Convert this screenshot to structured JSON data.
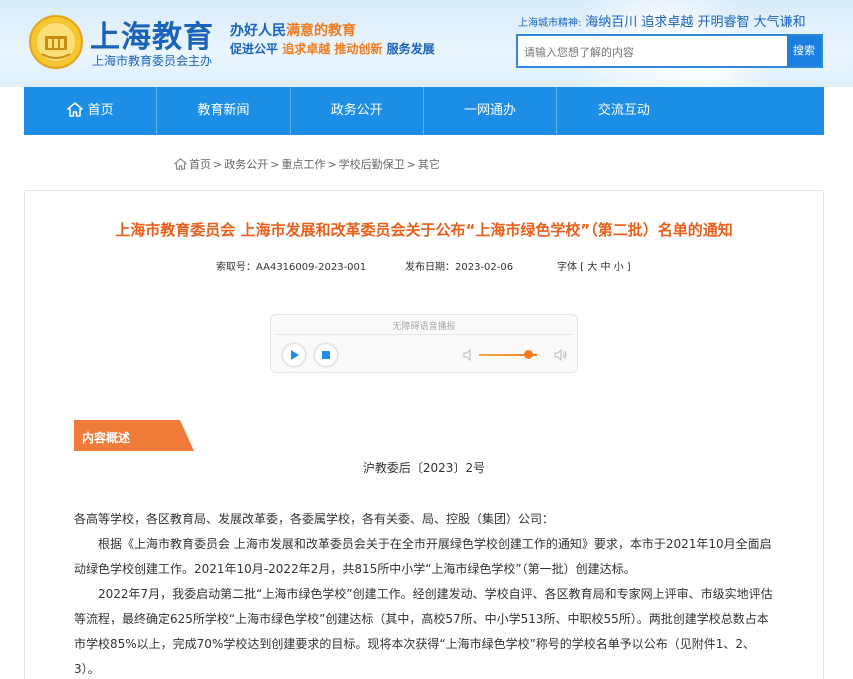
{
  "header": {
    "site_title": "上海教育",
    "site_subtitle": "上海市教育委员会主办",
    "slogan_line1_a": "办好人民",
    "slogan_line1_hl": "满意的教育",
    "slogan_line2_a": "促进公平",
    "slogan_line2_b": "追求卓越",
    "slogan_line2_c": "推动创新",
    "slogan_line2_d": "服务发展",
    "spirit_label": "上海城市精神:",
    "spirit_text": "海纳百川 追求卓越 开明睿智 大气谦和",
    "search_placeholder": "请输入您想了解的内容",
    "search_button": "搜索"
  },
  "nav": {
    "items": [
      {
        "label": "首页"
      },
      {
        "label": "教育新闻"
      },
      {
        "label": "政务公开"
      },
      {
        "label": "一网通办"
      },
      {
        "label": "交流互动"
      }
    ]
  },
  "breadcrumb": {
    "items": [
      "首页",
      "政务公开",
      "重点工作",
      "学校后勤保卫",
      "其它"
    ]
  },
  "article": {
    "title": "上海市教育委员会 上海市发展和改革委员会关于公布“上海市绿色学校”（第二批）名单的通知",
    "index_label": "索取号：",
    "index_value": "AA4316009-2023-001",
    "date_label": "发布日期：",
    "date_value": "2023-02-06",
    "font_label": "字体",
    "font_options": "[ 大 中 小 ]"
  },
  "player": {
    "title": "无障碍语音播报",
    "volume_percent": 85
  },
  "summary": {
    "tag": "内容概述",
    "doc_number": "沪教委后〔2023〕2号",
    "paragraphs": [
      "各高等学校，各区教育局、发展改革委，各委属学校，各有关委、局、控股（集团）公司：",
      "根据《上海市教育委员会 上海市发展和改革委员会关于在全市开展绿色学校创建工作的通知》要求，本市于2021年10月全面启动绿色学校创建工作。2021年10月-2022年2月，共815所中小学“上海市绿色学校”（第一批）创建达标。",
      "2022年7月，我委启动第二批“上海市绿色学校”创建工作。经创建发动、学校自评、各区教育局和专家网上评审、市级实地评估等流程，最终确定625所学校“上海市绿色学校”创建达标（其中，高校57所、中小学513所、中职校55所）。两批创建学校总数占本市学校85%以上，完成70%学校达到创建要求的目标。现将本次获得“上海市绿色学校”称号的学校名单予以公布（见附件1、2、3）。"
    ]
  },
  "colors": {
    "nav_blue": "#1d8ee6",
    "title_orange": "#e8601c",
    "brand_blue": "#1a63b8"
  }
}
